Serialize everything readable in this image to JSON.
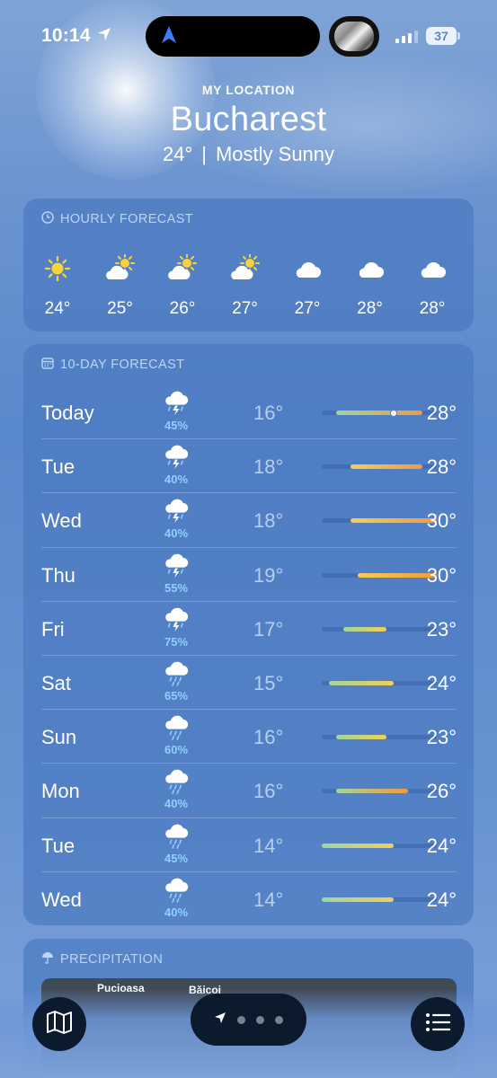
{
  "status_bar": {
    "time": "10:14",
    "battery": "37"
  },
  "header": {
    "location_label": "MY LOCATION",
    "city": "Bucharest",
    "current_temp": "24°",
    "separator": "|",
    "condition": "Mostly Sunny"
  },
  "hourly": {
    "title": "HOURLY FORECAST",
    "items": [
      {
        "icon": "sun-icon",
        "temp": "24°"
      },
      {
        "icon": "partly-sunny-icon",
        "temp": "25°"
      },
      {
        "icon": "partly-sunny-icon",
        "temp": "26°"
      },
      {
        "icon": "partly-sunny-icon",
        "temp": "27°"
      },
      {
        "icon": "cloud-icon",
        "temp": "27°"
      },
      {
        "icon": "cloud-icon",
        "temp": "28°"
      },
      {
        "icon": "cloud-icon",
        "temp": "28°"
      }
    ]
  },
  "daily": {
    "title": "10-DAY FORECAST",
    "range_min": 14,
    "range_max": 30,
    "current_temp_value": 24,
    "rows": [
      {
        "day": "Today",
        "icon": "thunderstorm-icon",
        "pct": "45%",
        "low": "16°",
        "high": "28°",
        "lo_val": 16,
        "hi_val": 28
      },
      {
        "day": "Tue",
        "icon": "thunderstorm-icon",
        "pct": "40%",
        "low": "18°",
        "high": "28°",
        "lo_val": 18,
        "hi_val": 28
      },
      {
        "day": "Wed",
        "icon": "thunderstorm-icon",
        "pct": "40%",
        "low": "18°",
        "high": "30°",
        "lo_val": 18,
        "hi_val": 30
      },
      {
        "day": "Thu",
        "icon": "thunderstorm-icon",
        "pct": "55%",
        "low": "19°",
        "high": "30°",
        "lo_val": 19,
        "hi_val": 30
      },
      {
        "day": "Fri",
        "icon": "thunderstorm-icon",
        "pct": "75%",
        "low": "17°",
        "high": "23°",
        "lo_val": 17,
        "hi_val": 23
      },
      {
        "day": "Sat",
        "icon": "rain-icon",
        "pct": "65%",
        "low": "15°",
        "high": "24°",
        "lo_val": 15,
        "hi_val": 24
      },
      {
        "day": "Sun",
        "icon": "rain-icon",
        "pct": "60%",
        "low": "16°",
        "high": "23°",
        "lo_val": 16,
        "hi_val": 23
      },
      {
        "day": "Mon",
        "icon": "rain-icon",
        "pct": "40%",
        "low": "16°",
        "high": "26°",
        "lo_val": 16,
        "hi_val": 26
      },
      {
        "day": "Tue",
        "icon": "rain-icon",
        "pct": "45%",
        "low": "14°",
        "high": "24°",
        "lo_val": 14,
        "hi_val": 24
      },
      {
        "day": "Wed",
        "icon": "rain-icon",
        "pct": "40%",
        "low": "14°",
        "high": "24°",
        "lo_val": 14,
        "hi_val": 24
      }
    ]
  },
  "precipitation": {
    "title": "PRECIPITATION",
    "map_labels": [
      "Pucioasa",
      "Băicoi"
    ]
  },
  "colors": {
    "card": "#4c7ac1",
    "cool": "#9fd6a0",
    "mild": "#f2cf54",
    "warm": "#f19a3e",
    "precip_text": "#8fd0ff"
  }
}
